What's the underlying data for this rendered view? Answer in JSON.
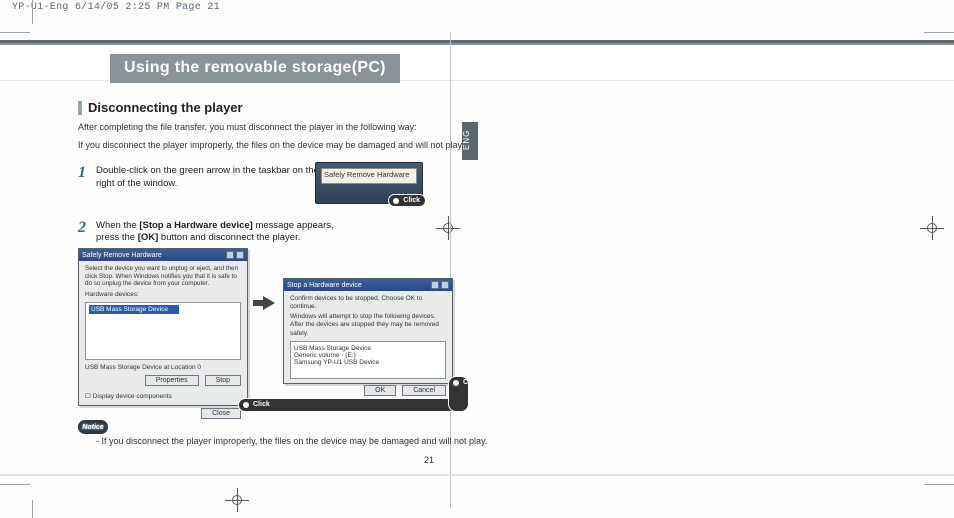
{
  "slug": "YP-U1-Eng  6/14/05 2:25 PM  Page 21",
  "chapter_title": "Using the removable storage(PC)",
  "lang_tab": "ENG",
  "section": {
    "title": "Disconnecting the player",
    "intro1": "After completing the file transfer, you must disconnect the player in the following way:",
    "intro2": "If you disconnect the player improperly, the files on the device may be damaged and will not play."
  },
  "steps": [
    {
      "num": "1",
      "text_pre": "Double-click on the green arrow in the taskbar on the bottom right of the window.",
      "text_bold1": "",
      "text_mid": "",
      "text_bold2": "",
      "text_post": ""
    },
    {
      "num": "2",
      "text_pre": "When the ",
      "text_bold1": "[Stop a Hardware device]",
      "text_mid": " message appears, press the ",
      "text_bold2": "[OK]",
      "text_post": " button and disconnect the player."
    }
  ],
  "taskbar_tooltip": "Safely Remove Hardware",
  "click_label": "Click",
  "dialog1": {
    "title": "Safely Remove Hardware",
    "instr": "Select the device you want to unplug or eject, and then click Stop. When Windows notifies you that it is safe to do so unplug the device from your computer.",
    "hw_label": "Hardware devices:",
    "selected": "USB Mass Storage Device",
    "loc": "USB Mass Storage Device at Location 0",
    "btn_properties": "Properties",
    "btn_stop": "Stop",
    "chk": "Display device components",
    "btn_close": "Close"
  },
  "dialog2": {
    "title": "Stop a Hardware device",
    "msg1": "Confirm devices to be stopped. Choose OK to continue.",
    "msg2": "Windows will attempt to stop the following devices. After the devices are stopped they may be removed safely.",
    "item1": "USB Mass Storage Device",
    "item2": "Generic volume - (E:)",
    "item3": "Samsung YP-U1 USB Device",
    "btn_ok": "OK",
    "btn_cancel": "Cancel"
  },
  "notice": {
    "badge": "Notice",
    "text": "- If you disconnect the player improperly, the files on the device may be damaged and will not play."
  },
  "page_number": "21"
}
